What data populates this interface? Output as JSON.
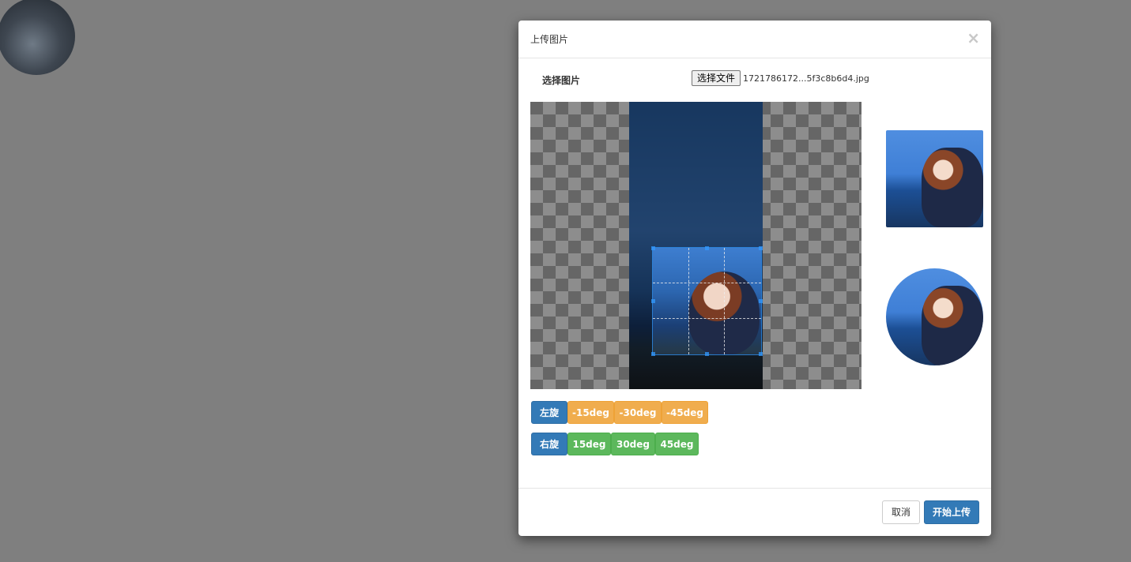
{
  "page": {
    "avatar_icon": "user-avatar"
  },
  "modal": {
    "title": "上传图片",
    "close_icon": "×"
  },
  "file_input": {
    "label": "选择图片",
    "button": "选择文件",
    "file_name": "1721786172...5f3c8b6d4.jpg"
  },
  "rotate_left": {
    "label": "左旋",
    "steps": [
      "-15deg",
      "-30deg",
      "-45deg"
    ]
  },
  "rotate_right": {
    "label": "右旋",
    "steps": [
      "15deg",
      "30deg",
      "45deg"
    ]
  },
  "footer": {
    "cancel": "取消",
    "upload": "开始上传"
  },
  "colors": {
    "primary": "#337ab7",
    "warning": "#f0ad4e",
    "success": "#5cb85c",
    "backdrop": "#7f7f7f"
  }
}
